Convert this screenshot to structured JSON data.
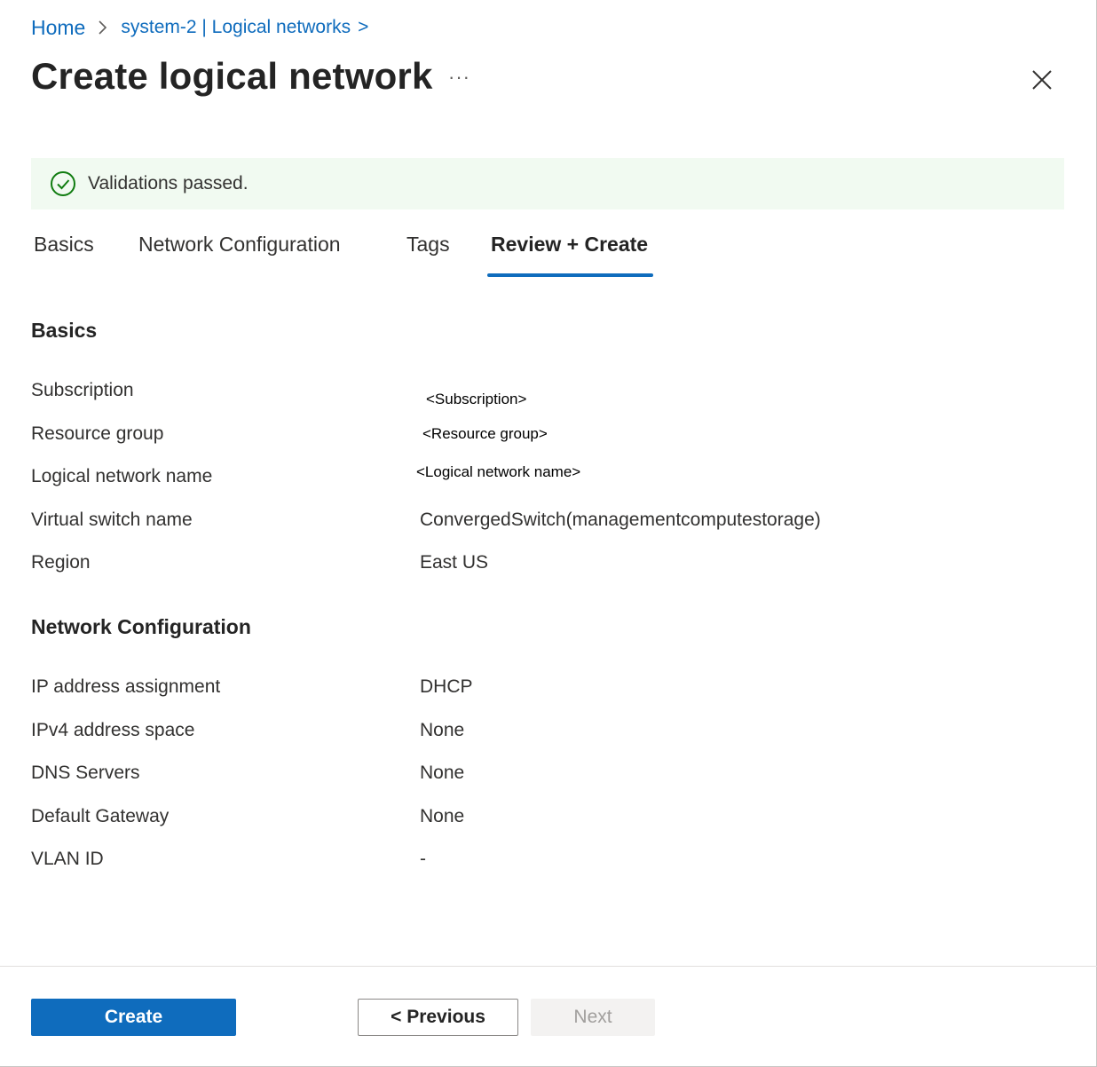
{
  "breadcrumb": {
    "home": "Home",
    "parent": "system-2 | Logical networks",
    "trail_sep": ">"
  },
  "header": {
    "title": "Create logical network",
    "more_label": "···"
  },
  "banner": {
    "message": "Validations passed.",
    "color": "#107c10"
  },
  "tabs": [
    {
      "label": "Basics",
      "active": false
    },
    {
      "label": "Network Configuration",
      "active": false
    },
    {
      "label": "Tags",
      "active": false
    },
    {
      "label": "Review + Create",
      "active": true
    }
  ],
  "basics": {
    "title": "Basics",
    "rows": [
      {
        "label": "Subscription",
        "value": "<Subscription>"
      },
      {
        "label": "Resource group",
        "value": "<Resource group>"
      },
      {
        "label": "Logical network name",
        "value": "<Logical network name>"
      },
      {
        "label": "Virtual switch name",
        "value": "ConvergedSwitch(managementcomputestorage)"
      },
      {
        "label": "Region",
        "value": "East US"
      }
    ]
  },
  "network": {
    "title": "Network Configuration",
    "rows": [
      {
        "label": "IP address assignment",
        "value": "DHCP"
      },
      {
        "label": "IPv4 address space",
        "value": "None"
      },
      {
        "label": "DNS Servers",
        "value": "None"
      },
      {
        "label": "Default Gateway",
        "value": "None"
      },
      {
        "label": "VLAN ID",
        "value": "-"
      }
    ]
  },
  "footer": {
    "create_label": "Create",
    "previous_label": "< Previous",
    "next_label": "Next"
  },
  "colors": {
    "accent": "#0f6cbd",
    "success_bg": "#f1faf1"
  }
}
